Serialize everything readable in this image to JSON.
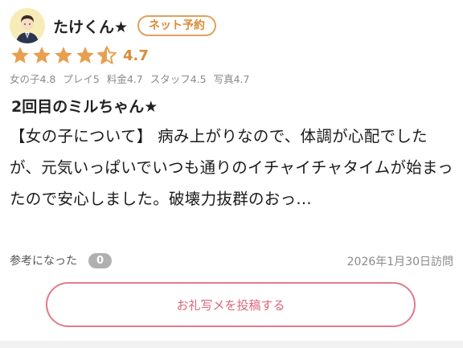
{
  "reviewer": {
    "name": "たけくん★",
    "badge": "ネット予約"
  },
  "rating": {
    "value": "4.7",
    "stars": 4.7,
    "star_color": "#e6a050"
  },
  "sub_scores": [
    {
      "label": "女の子4.8"
    },
    {
      "label": "プレイ5"
    },
    {
      "label": "料金4.7"
    },
    {
      "label": "スタッフ4.5"
    },
    {
      "label": "写真4.7"
    }
  ],
  "review": {
    "title": "2回目のミルちゃん★",
    "body": "【女の子について】 病み上がりなので、体調が心配でしたが、元気いっぱいでいつも通りのイチャイチャタイムが始まったので安心しました。破壊力抜群のおっ..."
  },
  "helpful": {
    "label": "参考になった",
    "count": "0"
  },
  "visit_date": "2026年1月30日訪問",
  "post_button": {
    "label": "お礼写メを投稿する"
  },
  "colors": {
    "accent_orange": "#d98c3a",
    "button_pink": "#dc6478"
  }
}
